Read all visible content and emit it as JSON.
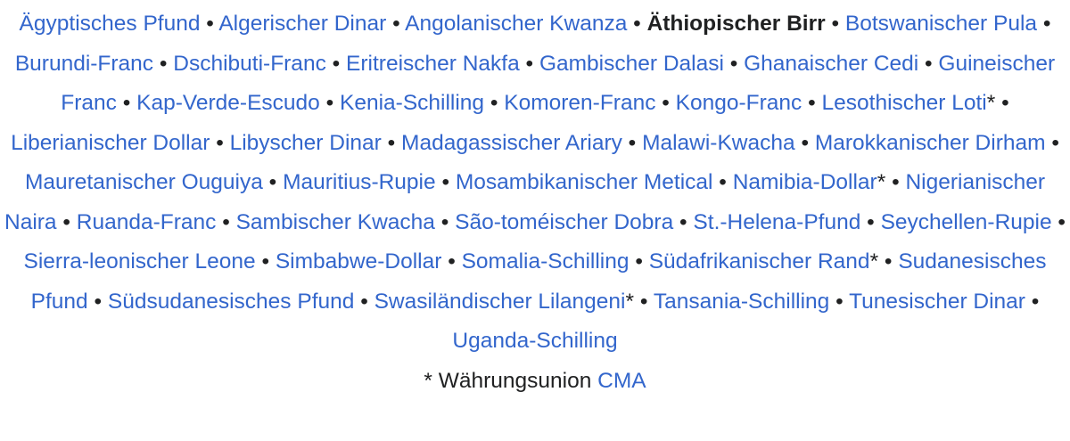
{
  "currencies": [
    {
      "label": "Ägyptisches Pfund",
      "marker": "",
      "current": false
    },
    {
      "label": "Algerischer Dinar",
      "marker": "",
      "current": false
    },
    {
      "label": "Angolanischer Kwanza",
      "marker": "",
      "current": false
    },
    {
      "label": "Äthiopischer Birr",
      "marker": "",
      "current": true
    },
    {
      "label": "Botswanischer Pula",
      "marker": "",
      "current": false
    },
    {
      "label": "Burundi-Franc",
      "marker": "",
      "current": false
    },
    {
      "label": "Dschibuti-Franc",
      "marker": "",
      "current": false
    },
    {
      "label": "Eritreischer Nakfa",
      "marker": "",
      "current": false
    },
    {
      "label": "Gambischer Dalasi",
      "marker": "",
      "current": false
    },
    {
      "label": "Ghanaischer Cedi",
      "marker": "",
      "current": false
    },
    {
      "label": "Guineischer Franc",
      "marker": "",
      "current": false
    },
    {
      "label": "Kap-Verde-Escudo",
      "marker": "",
      "current": false
    },
    {
      "label": "Kenia-Schilling",
      "marker": "",
      "current": false
    },
    {
      "label": "Komoren-Franc",
      "marker": "",
      "current": false
    },
    {
      "label": "Kongo-Franc",
      "marker": "",
      "current": false
    },
    {
      "label": "Lesothischer Loti",
      "marker": "*",
      "current": false
    },
    {
      "label": "Liberianischer Dollar",
      "marker": "",
      "current": false
    },
    {
      "label": "Libyscher Dinar",
      "marker": "",
      "current": false
    },
    {
      "label": "Madagassischer Ariary",
      "marker": "",
      "current": false
    },
    {
      "label": "Malawi-Kwacha",
      "marker": "",
      "current": false
    },
    {
      "label": "Marokkanischer Dirham",
      "marker": "",
      "current": false
    },
    {
      "label": "Mauretanischer Ouguiya",
      "marker": "",
      "current": false
    },
    {
      "label": "Mauritius-Rupie",
      "marker": "",
      "current": false
    },
    {
      "label": "Mosambikanischer Metical",
      "marker": "",
      "current": false
    },
    {
      "label": "Namibia-Dollar",
      "marker": "*",
      "current": false
    },
    {
      "label": "Nigerianischer Naira",
      "marker": "",
      "current": false
    },
    {
      "label": "Ruanda-Franc",
      "marker": "",
      "current": false
    },
    {
      "label": "Sambischer Kwacha",
      "marker": "",
      "current": false
    },
    {
      "label": "São-toméischer Dobra",
      "marker": "",
      "current": false
    },
    {
      "label": "St.-Helena-Pfund",
      "marker": "",
      "current": false
    },
    {
      "label": "Seychellen-Rupie",
      "marker": "",
      "current": false
    },
    {
      "label": "Sierra-leonischer Leone",
      "marker": "",
      "current": false
    },
    {
      "label": "Simbabwe-Dollar",
      "marker": "",
      "current": false
    },
    {
      "label": "Somalia-Schilling",
      "marker": "",
      "current": false
    },
    {
      "label": "Südafrikanischer Rand",
      "marker": "*",
      "current": false
    },
    {
      "label": "Sudanesisches Pfund",
      "marker": "",
      "current": false
    },
    {
      "label": "Südsudanesisches Pfund",
      "marker": "",
      "current": false
    },
    {
      "label": "Swasiländischer Lilangeni",
      "marker": "*",
      "current": false
    },
    {
      "label": "Tansania-Schilling",
      "marker": "",
      "current": false
    },
    {
      "label": "Tunesischer Dinar",
      "marker": "",
      "current": false
    },
    {
      "label": "Uganda-Schilling",
      "marker": "",
      "current": false
    }
  ],
  "separator": "•",
  "footnote": {
    "text": "* Währungsunion",
    "link": "CMA"
  },
  "colors": {
    "link": "#3366cc",
    "text": "#202122",
    "background": "#ffffff"
  }
}
